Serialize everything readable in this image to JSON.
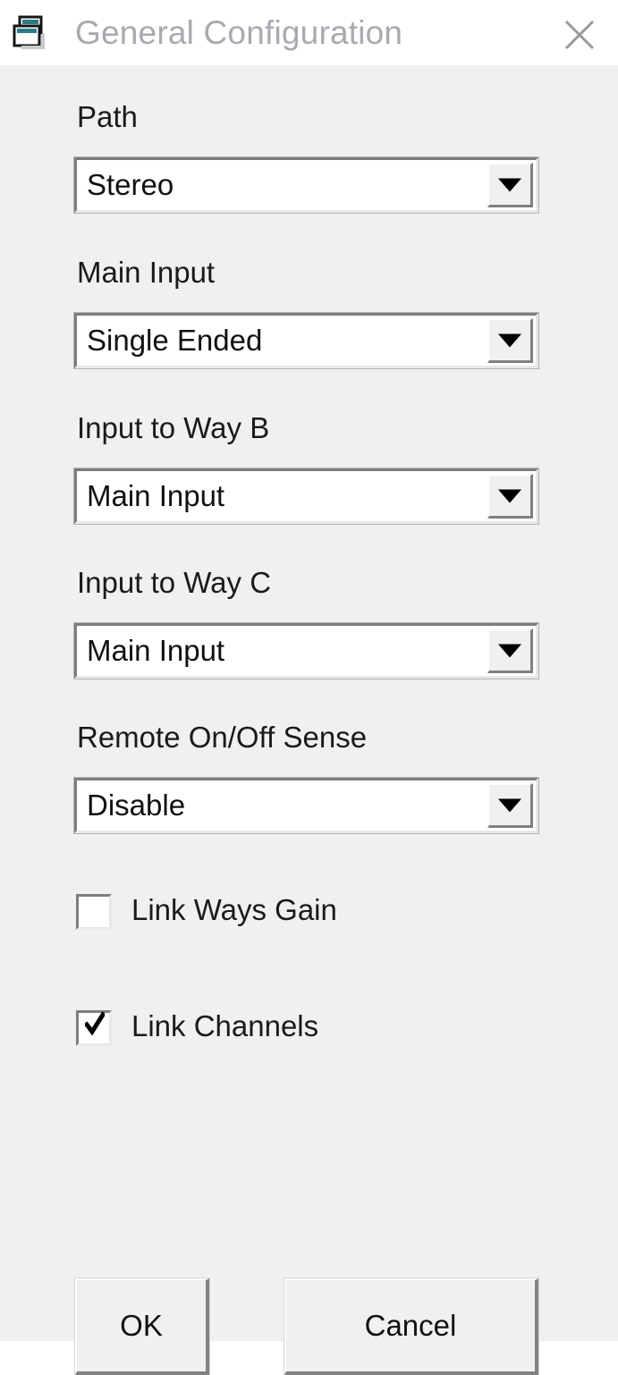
{
  "window": {
    "title": "General Configuration",
    "icon": "window-cascade-icon",
    "close_label": "×",
    "title_color": "#a9a9b0",
    "body_color": "#f0f0f0",
    "titlebar_color": "#ffffff",
    "accent_color": "#2a7b86"
  },
  "fields": [
    {
      "label": "Path",
      "value": "Stereo"
    },
    {
      "label": "Main Input",
      "value": "Single Ended"
    },
    {
      "label": "Input to Way B",
      "value": "Main Input"
    },
    {
      "label": "Input to Way C",
      "value": "Main Input"
    },
    {
      "label": "Remote On/Off Sense",
      "value": "Disable"
    }
  ],
  "checkboxes": [
    {
      "label": "Link Ways Gain",
      "checked": false
    },
    {
      "label": "Link Channels",
      "checked": true
    }
  ],
  "buttons": {
    "ok": "OK",
    "cancel": "Cancel"
  }
}
